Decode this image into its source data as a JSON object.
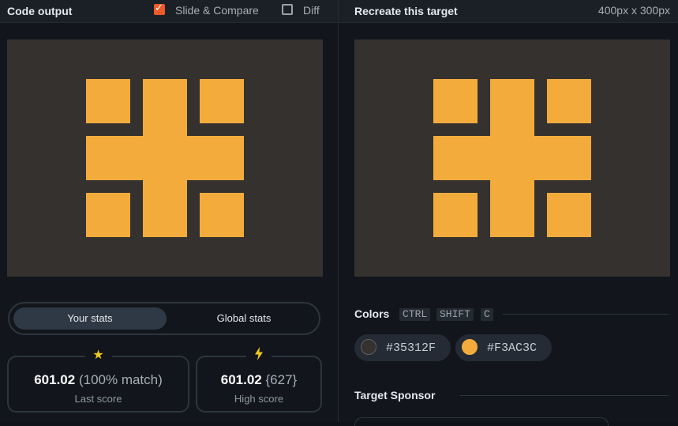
{
  "left": {
    "title": "Code output",
    "slide_compare": {
      "label": "Slide & Compare",
      "checked": true
    },
    "diff": {
      "label": "Diff",
      "checked": false
    }
  },
  "right": {
    "title": "Recreate this target",
    "dimensions": "400px x 300px"
  },
  "stats": {
    "tabs": [
      "Your stats",
      "Global stats"
    ],
    "active_tab": "Your stats",
    "last": {
      "value": "601.02",
      "extra": "(100% match)",
      "label": "Last score",
      "icon": "star-icon"
    },
    "high": {
      "value": "601.02",
      "extra": "{627}",
      "label": "High score",
      "icon": "bolt-icon"
    }
  },
  "colors": {
    "label": "Colors",
    "shortcut": [
      "CTRL",
      "SHIFT",
      "C"
    ],
    "swatches": [
      {
        "hex": "#35312F"
      },
      {
        "hex": "#F3AC3C"
      }
    ]
  },
  "sponsor": {
    "label": "Target Sponsor"
  }
}
